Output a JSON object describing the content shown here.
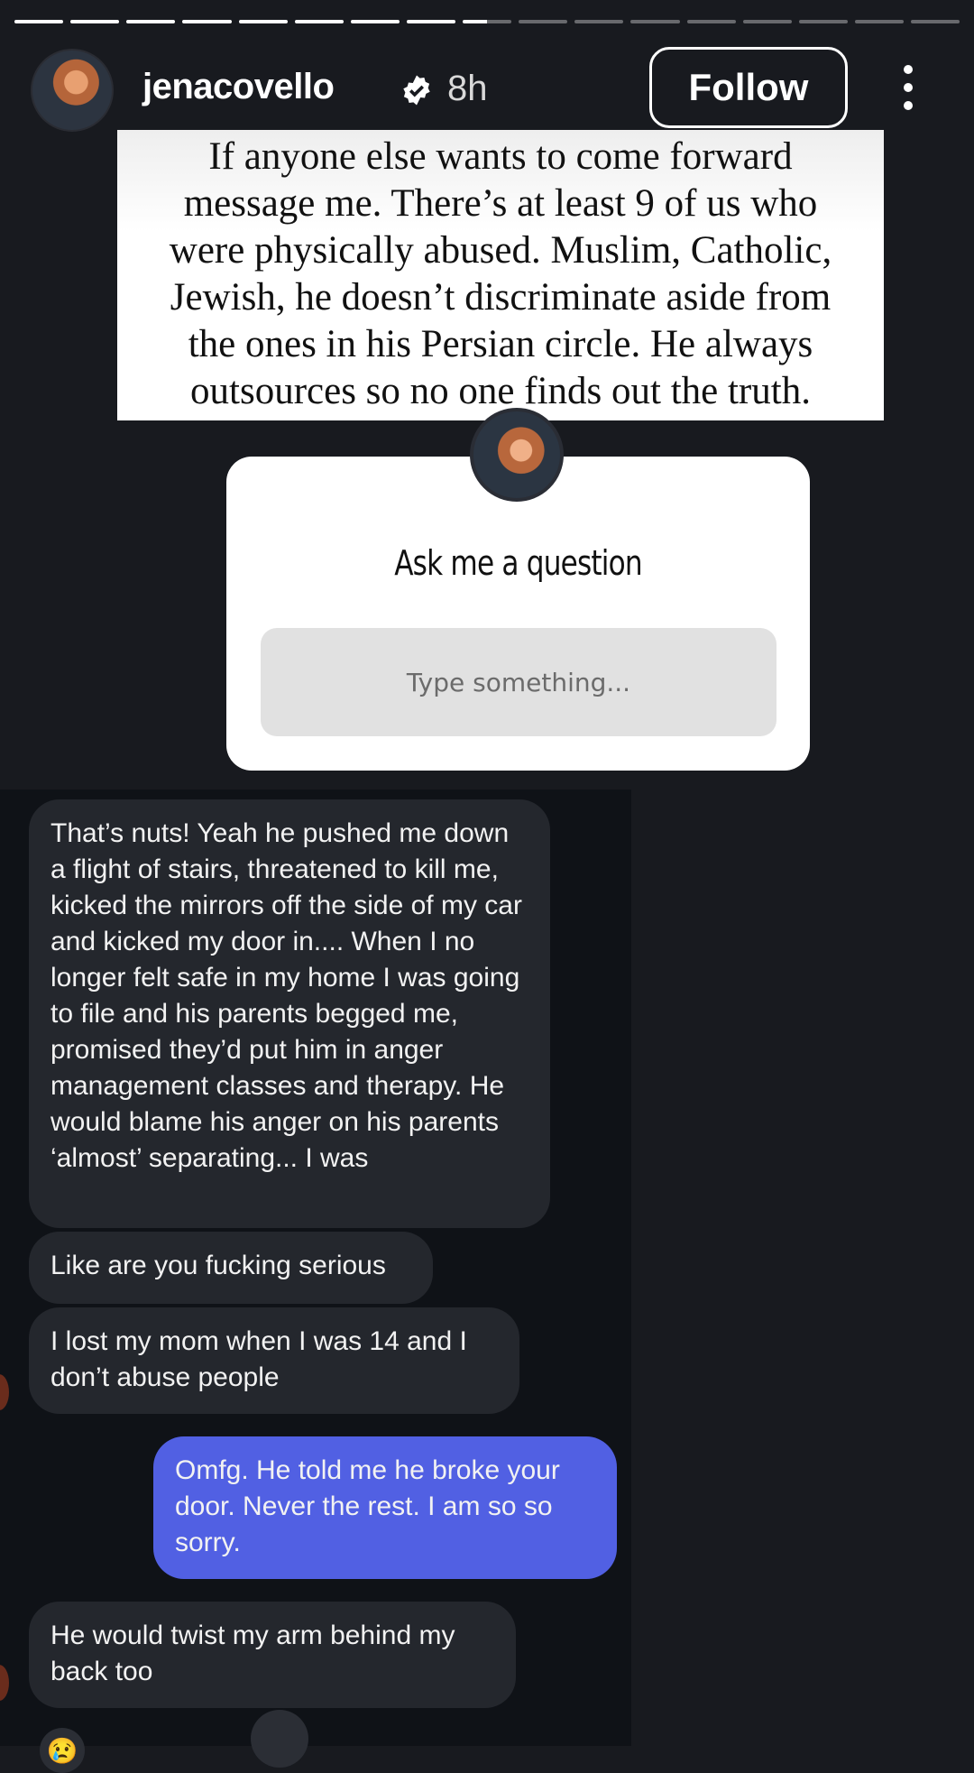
{
  "story": {
    "segments_total": 17,
    "segments_done": 8
  },
  "header": {
    "username": "jenacovello",
    "time": "8h",
    "follow_label": "Follow",
    "verified_icon": "verified-badge-icon",
    "more_icon": "more-vertical-icon"
  },
  "quote": {
    "line1": "If anyone else wants to come forward",
    "line2": "message me. There’s at least 9 of us who",
    "line3": "were physically abused. Muslim, Catholic,",
    "line4": "Jewish, he doesn’t discriminate aside from",
    "line5": "the ones in his Persian circle. He always",
    "line6": "outsources so no one finds out the truth."
  },
  "question_sticker": {
    "title": "Ask me a question",
    "placeholder": "Type something..."
  },
  "messages": [
    {
      "direction": "in",
      "text": "That’s nuts! Yeah he pushed me down a flight of stairs, threatened to kill me, kicked the mirrors off the side of my car and kicked my door in.... When I no longer felt safe in my home I was going to file and his parents begged me, promised they’d put him in anger management classes and therapy. He would blame his anger on his parents ‘almost’ separating... I was"
    },
    {
      "direction": "in",
      "text": "Like are you fucking serious"
    },
    {
      "direction": "in",
      "text": "I lost my mom when I was 14 and I don’t abuse people"
    },
    {
      "direction": "out",
      "text": "Omfg. He told me he broke your door. Never the rest. I am so so sorry."
    },
    {
      "direction": "in",
      "text": "He would twist my arm behind my back too"
    }
  ],
  "reaction_emoji": "😢"
}
